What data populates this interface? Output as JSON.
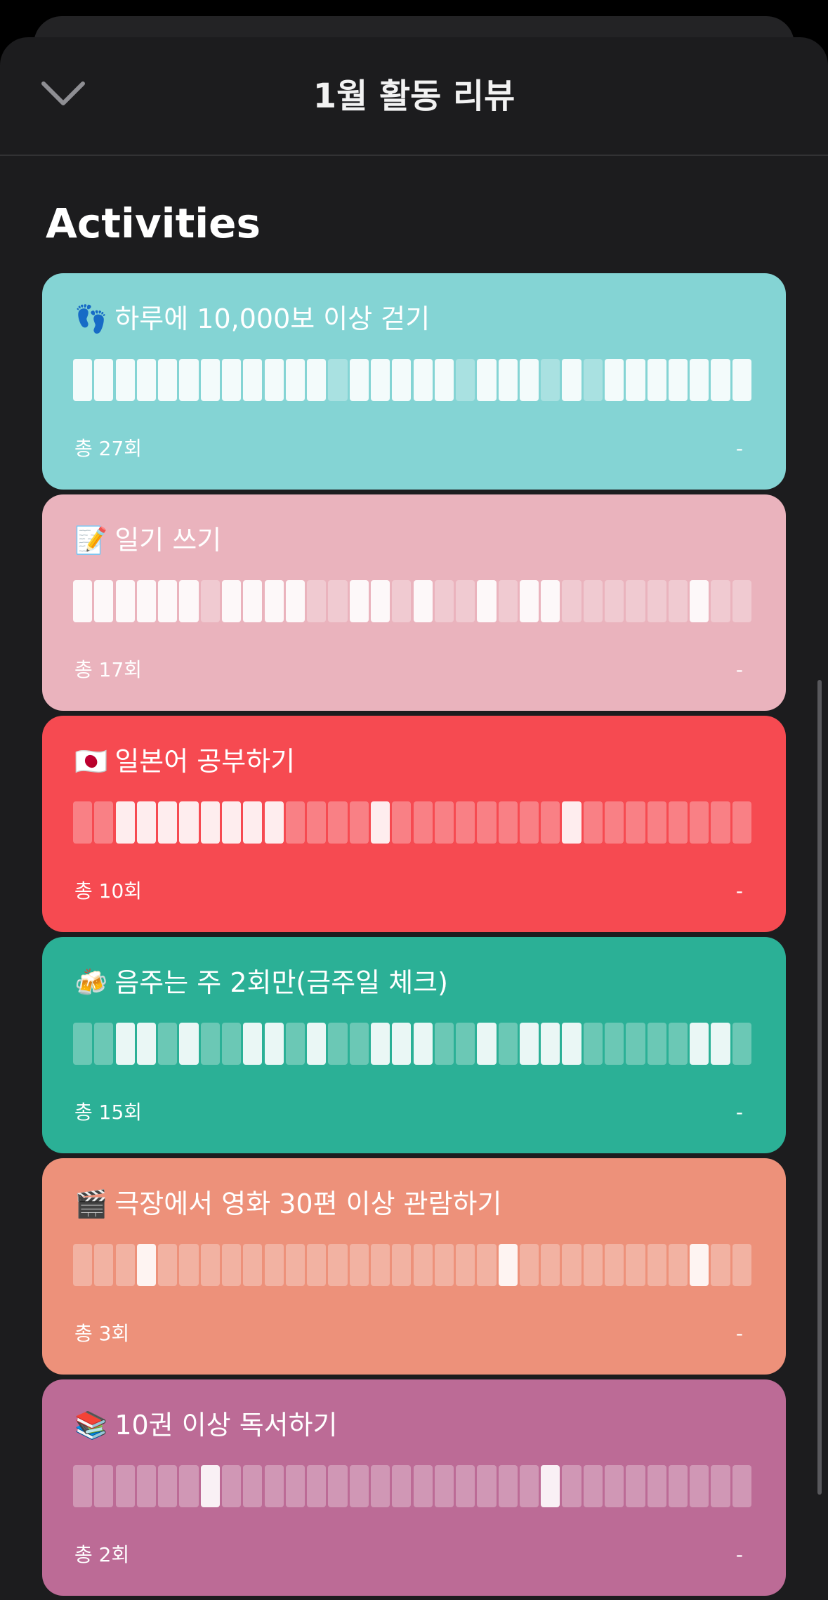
{
  "sheet": {
    "title": "1월 활동 리뷰",
    "close_icon": "chevron-down-icon"
  },
  "section_title": "Activities",
  "activities": [
    {
      "emoji": "👣",
      "name": "하루에 10,000보 이상 걷기",
      "total": "총 27회",
      "trailing": "-",
      "color": "#84d4d4",
      "completed_days": [
        1,
        1,
        1,
        1,
        1,
        1,
        1,
        1,
        1,
        1,
        1,
        1,
        0,
        1,
        1,
        1,
        1,
        1,
        0,
        1,
        1,
        1,
        0,
        1,
        0,
        1,
        1,
        1,
        1,
        1,
        1,
        1
      ]
    },
    {
      "emoji": "📝",
      "name": "일기 쓰기",
      "total": "총 17회",
      "trailing": "-",
      "color": "#eab3bd",
      "completed_days": [
        1,
        1,
        1,
        1,
        1,
        1,
        0,
        1,
        1,
        1,
        1,
        0,
        0,
        1,
        1,
        0,
        1,
        0,
        0,
        1,
        0,
        1,
        1,
        0,
        0,
        0,
        0,
        0,
        0,
        1,
        0,
        0
      ]
    },
    {
      "emoji": "🇯🇵",
      "name": "일본어 공부하기",
      "total": "총 10회",
      "trailing": "-",
      "color": "#f64a51",
      "completed_days": [
        0,
        0,
        1,
        1,
        1,
        1,
        1,
        1,
        1,
        1,
        0,
        0,
        0,
        0,
        1,
        0,
        0,
        0,
        0,
        0,
        0,
        0,
        0,
        1,
        0,
        0,
        0,
        0,
        0,
        0,
        0,
        0
      ]
    },
    {
      "emoji": "🍻",
      "name": "음주는 주 2회만(금주일 체크)",
      "total": "총 15회",
      "trailing": "-",
      "color": "#2bb096",
      "completed_days": [
        0,
        0,
        1,
        1,
        0,
        1,
        0,
        0,
        1,
        1,
        0,
        1,
        0,
        0,
        1,
        1,
        1,
        0,
        0,
        1,
        0,
        1,
        1,
        1,
        0,
        0,
        0,
        0,
        0,
        1,
        1,
        0
      ]
    },
    {
      "emoji": "🎬",
      "name": "극장에서 영화 30편 이상 관람하기",
      "total": "총 3회",
      "trailing": "-",
      "color": "#ed917a",
      "completed_days": [
        0,
        0,
        0,
        1,
        0,
        0,
        0,
        0,
        0,
        0,
        0,
        0,
        0,
        0,
        0,
        0,
        0,
        0,
        0,
        0,
        1,
        0,
        0,
        0,
        0,
        0,
        0,
        0,
        0,
        1,
        0,
        0
      ]
    },
    {
      "emoji": "📚",
      "name": "10권 이상 독서하기",
      "total": "총 2회",
      "trailing": "-",
      "color": "#bc6b96",
      "completed_days": [
        0,
        0,
        0,
        0,
        0,
        0,
        1,
        0,
        0,
        0,
        0,
        0,
        0,
        0,
        0,
        0,
        0,
        0,
        0,
        0,
        0,
        0,
        1,
        0,
        0,
        0,
        0,
        0,
        0,
        0,
        0,
        0
      ]
    }
  ]
}
